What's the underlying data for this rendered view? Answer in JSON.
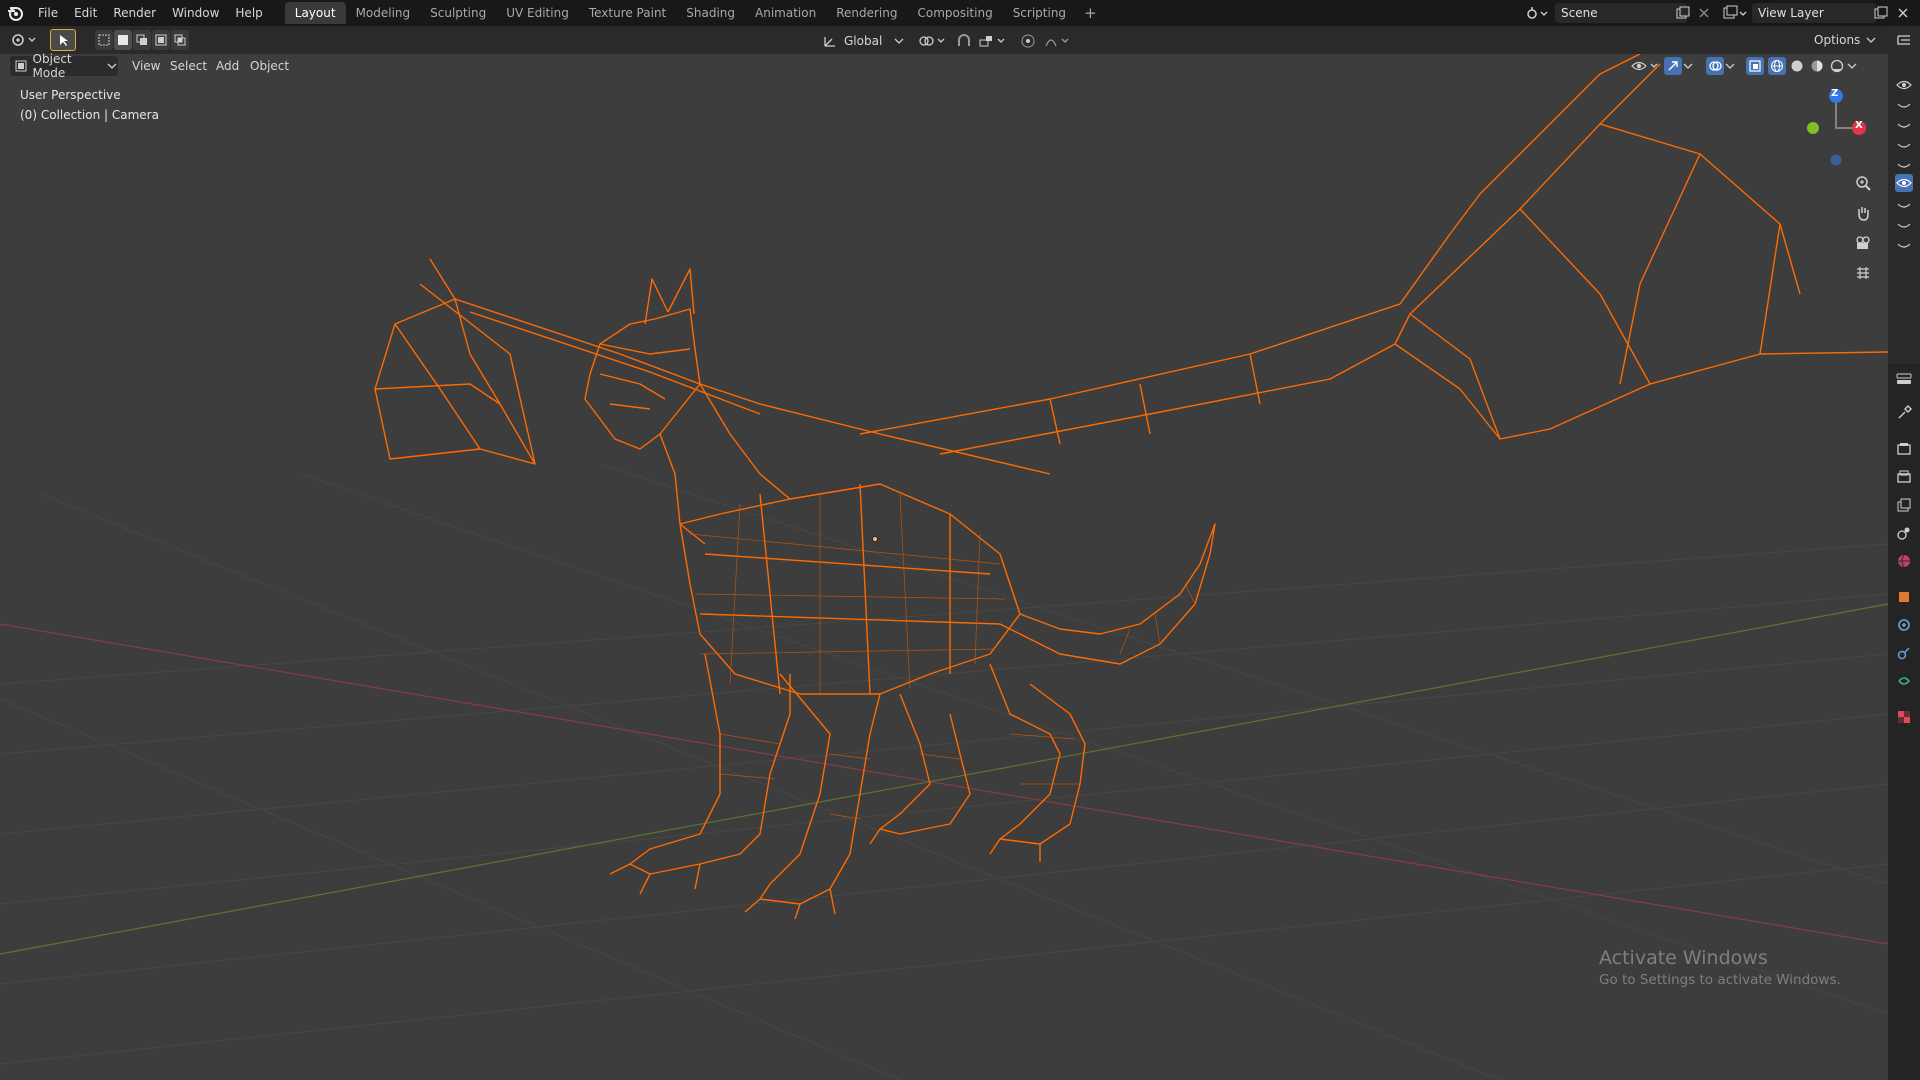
{
  "menu": [
    "File",
    "Edit",
    "Render",
    "Window",
    "Help"
  ],
  "workspaces": [
    "Layout",
    "Modeling",
    "Sculpting",
    "UV Editing",
    "Texture Paint",
    "Shading",
    "Animation",
    "Rendering",
    "Compositing",
    "Scripting"
  ],
  "active_workspace": "Layout",
  "add_workspace": "+",
  "scene": {
    "label": "Scene"
  },
  "view_layer": {
    "label": "View Layer"
  },
  "header": {
    "mode": "Object Mode",
    "menus": [
      "View",
      "Select",
      "Add",
      "Object"
    ],
    "transform_orientation": "Global",
    "options": "Options"
  },
  "viewport": {
    "perspective": "User Perspective",
    "collection": "(0) Collection | Camera",
    "axes": {
      "x": "X",
      "z": "Z"
    },
    "wire_color": "#ff6a00",
    "background": "#3d3d3d"
  },
  "watermark": {
    "line1": "Activate Windows",
    "line2": "Go to Settings to activate Windows."
  },
  "icons": {
    "nav": [
      "zoom-icon",
      "pan-hand-icon",
      "camera-view-icon",
      "ortho-grid-icon"
    ],
    "properties": [
      "tool-icon",
      "render-icon",
      "output-icon",
      "view-layer-icon",
      "scene-icon",
      "world-icon",
      "object-icon",
      "modifier-icon",
      "physics-icon",
      "constraint-icon",
      "data-icon",
      "texture-icon"
    ]
  }
}
